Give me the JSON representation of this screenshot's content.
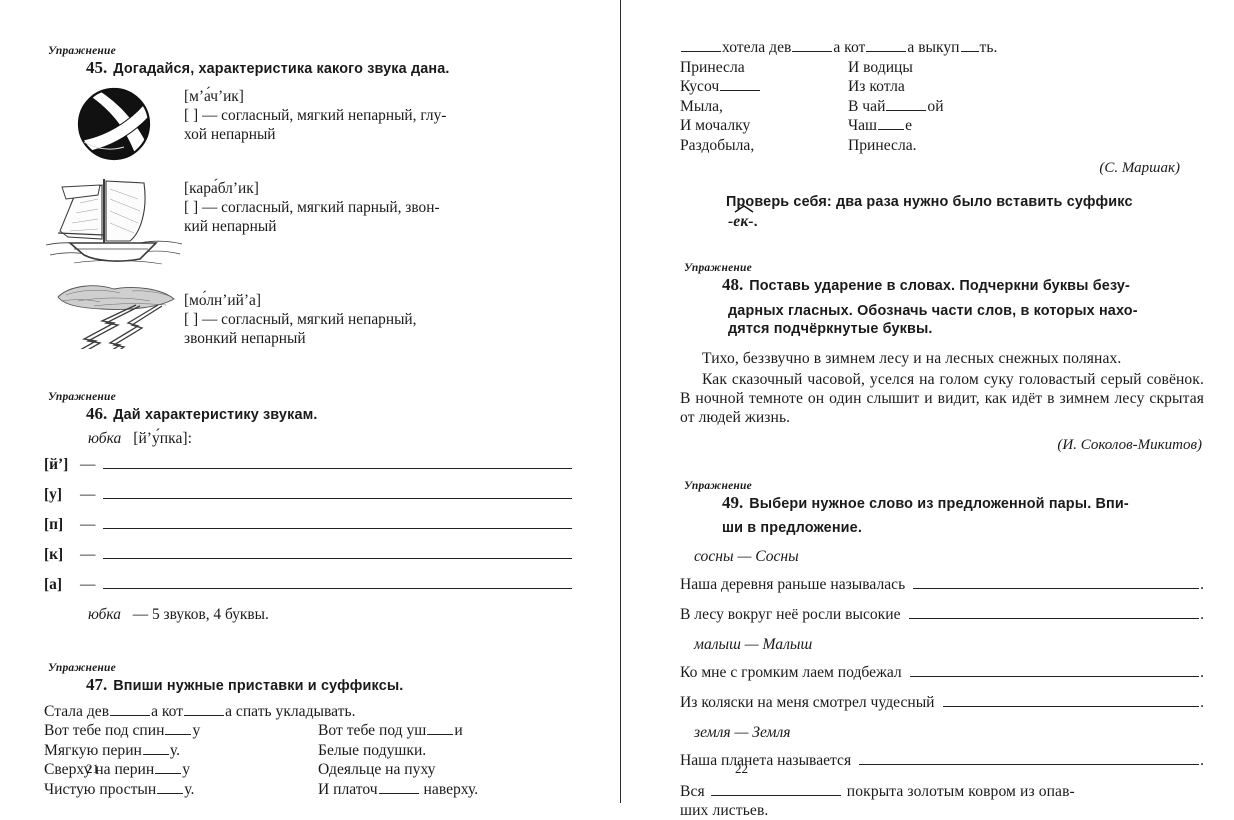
{
  "spread": {
    "left_page_number": "21",
    "right_page_number": "22"
  },
  "labels": {
    "exercise_word": "Упражнение"
  },
  "left_page": {
    "ex45": {
      "number": "45.",
      "task": "Догадайся, характеристика какого звука дана.",
      "items": [
        {
          "picture": "ball-illustration",
          "transcription": "[м’а́ч’ик]",
          "characteristic": "[  ]  —  согласный,  мягкий  непарный,  глу-",
          "characteristic_cont": "хой  непарный"
        },
        {
          "picture": "sailboat-illustration",
          "transcription": "[кара́бл’ик]",
          "characteristic": "[  ]  —  согласный,  мягкий  парный,  звон-",
          "characteristic_cont": "кий  непарный"
        },
        {
          "picture": "lightning-illustration",
          "transcription": "[мо́лн’ий’а]",
          "characteristic": "[  ]  —  согласный,  мягкий  непарный,",
          "characteristic_cont": "звонкий  непарный"
        }
      ]
    },
    "ex46": {
      "number": "46.",
      "task": "Дай характеристику звукам.",
      "word": "юбка",
      "word_transcription": "[й’у́пка]:",
      "sounds": [
        "[й’]",
        "[у]",
        "[п]",
        "[к]",
        "[а]"
      ],
      "dash": "—",
      "summary_word": "юбка",
      "summary_rest": "—  5  звуков,  4  буквы."
    },
    "ex47": {
      "number": "47.",
      "task": "Впиши нужные приставки и суффиксы.",
      "line1_a": "Стала  дев",
      "line1_b": "а  кот",
      "line1_c": "а  спать  укладывать.",
      "columns": {
        "left": [
          {
            "a": "Вот  тебе  под  спин",
            "b": "у"
          },
          {
            "a": "Мягкую  перин",
            "b": "у."
          },
          {
            "a": "Сверху  на  перин",
            "b": "у"
          },
          {
            "a": "Чистую  простын",
            "b": "у."
          }
        ],
        "right": [
          {
            "a": "Вот  тебе  под  уш",
            "b": "и"
          },
          {
            "a": "Белые  подушки.",
            "b": ""
          },
          {
            "a": "Одеяльце  на  пуху",
            "b": ""
          },
          {
            "a": "И  платоч",
            "b": "  наверху."
          }
        ]
      }
    }
  },
  "right_page": {
    "poem_continued": {
      "line1_a": "хотела  дев",
      "line1_b": "а  кот",
      "line1_c": "а  выкуп",
      "line1_d": "ть.",
      "columns": {
        "left": [
          {
            "a": "Принесла",
            "b": ""
          },
          {
            "a": "Кусоч",
            "b": ""
          },
          {
            "a": "Мыла,",
            "b": ""
          },
          {
            "a": "И  мочалку",
            "b": ""
          },
          {
            "a": "Раздобыла,",
            "b": ""
          }
        ],
        "right": [
          {
            "a": "И  водицы",
            "b": ""
          },
          {
            "a": "Из  котла",
            "b": ""
          },
          {
            "a": "В  чай",
            "b": "ой"
          },
          {
            "a": "Чаш",
            "b": "е"
          },
          {
            "a": "Принесла.",
            "b": ""
          }
        ]
      },
      "attribution": "(С.  Маршак)"
    },
    "check_yourself": {
      "text": "Проверь себя: два раза нужно было вставить суффикс",
      "suffix": "-ек-",
      "suffix_tail": "."
    },
    "ex48": {
      "number": "48.",
      "task": "Поставь ударение в словах. Подчеркни буквы безу-",
      "task_line2": "дарных гласных. Обозначь части слов, в которых нахо-",
      "task_line3": "дятся подчёркнутые буквы.",
      "paragraph1": "Тихо, беззвучно в зимнем лесу и на лесных снежных полянах.",
      "paragraph2": "Как сказочный часовой, уселся на голом суку головастый серый совёнок. В ночной темноте он один слышит и видит, как идёт в зимнем лесу скрытая от людей жизнь.",
      "attribution": "(И.  Соколов-Микитов)"
    },
    "ex49": {
      "number": "49.",
      "task": "Выбери нужное слово из предложенной пары. Впи-",
      "task_line2": "ши в предложение.",
      "groups": [
        {
          "pair": "сосны  —  Сосны",
          "sentences": [
            {
              "text": "Наша  деревня  раньше  называлась",
              "tail": "."
            },
            {
              "text": "В  лесу  вокруг  неё  росли  высокие",
              "tail": "."
            }
          ]
        },
        {
          "pair": "малыш  —  Малыш",
          "sentences": [
            {
              "text": "Ко  мне  с  громким  лаем  подбежал",
              "tail": "."
            },
            {
              "text": "Из  коляски  на  меня  смотрел  чудесный",
              "tail": "."
            }
          ]
        },
        {
          "pair": "земля  —  Земля",
          "sentences": [
            {
              "text": "Наша  планета  называется",
              "tail": "."
            }
          ]
        }
      ],
      "last_sentence_a": "Вся",
      "last_sentence_b": "покрыта  золотым  ковром  из  опав-",
      "last_sentence_c": "ших  листьев."
    }
  }
}
